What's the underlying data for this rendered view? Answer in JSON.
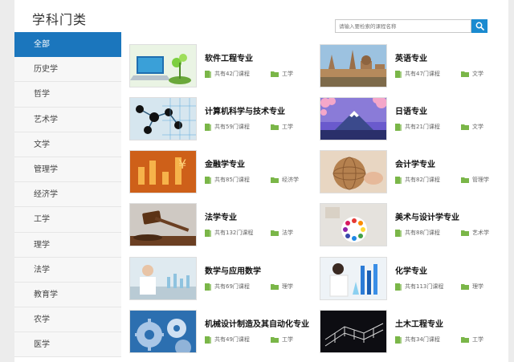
{
  "sidebar": {
    "title": "学科门类",
    "items": [
      "全部",
      "历史学",
      "哲学",
      "艺术学",
      "文学",
      "管理学",
      "经济学",
      "工学",
      "理学",
      "法学",
      "教育学",
      "农学",
      "医学"
    ],
    "active_index": 0
  },
  "search": {
    "placeholder": "请输入要检索的课程名称",
    "button_icon": "search-icon"
  },
  "courses": [
    {
      "title": "软件工程专业",
      "count": "共有42门课程",
      "category": "工学",
      "thumb": "laptop-plant"
    },
    {
      "title": "英语专业",
      "count": "共有47门课程",
      "category": "文学",
      "thumb": "oxford-city"
    },
    {
      "title": "计算机科学与技术专业",
      "count": "共有59门课程",
      "category": "工学",
      "thumb": "molecule-network"
    },
    {
      "title": "日语专业",
      "count": "共有21门课程",
      "category": "文学",
      "thumb": "mount-fuji"
    },
    {
      "title": "金融学专业",
      "count": "共有85门课程",
      "category": "经济学",
      "thumb": "gold-coins"
    },
    {
      "title": "会计学专业",
      "count": "共有82门课程",
      "category": "管理学",
      "thumb": "globe-hands"
    },
    {
      "title": "法学专业",
      "count": "共有132门课程",
      "category": "法学",
      "thumb": "gavel"
    },
    {
      "title": "美术与设计学专业",
      "count": "共有88门课程",
      "category": "艺术学",
      "thumb": "color-wheel"
    },
    {
      "title": "数学与应用数学",
      "count": "共有69门课程",
      "category": "理学",
      "thumb": "lab-scientist"
    },
    {
      "title": "化学专业",
      "count": "共有113门课程",
      "category": "理学",
      "thumb": "chemistry-flasks"
    },
    {
      "title": "机械设计制造及其自动化专业",
      "count": "共有49门课程",
      "category": "工学",
      "thumb": "gears"
    },
    {
      "title": "土木工程专业",
      "count": "共有34门课程",
      "category": "工学",
      "thumb": "bridge-structure"
    }
  ],
  "colors": {
    "accent": "#1b76bd",
    "search_button": "#1b8bd0",
    "book_icon": "#7ab648",
    "folder_icon": "#7ab648"
  },
  "icons": {
    "count": "book-icon",
    "category": "folder-icon"
  }
}
